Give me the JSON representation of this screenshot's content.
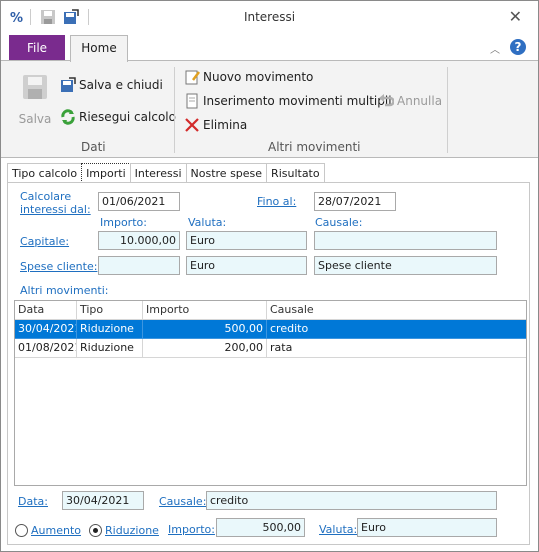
{
  "window": {
    "title": "Interessi"
  },
  "ribbon_tabs": {
    "file": "File",
    "home": "Home"
  },
  "ribbon": {
    "salva": "Salva",
    "salva_e_chiudi": "Salva e chiudi",
    "riesegui_calcolo": "Riesegui calcolo",
    "group_dati": "Dati",
    "nuovo_movimento": "Nuovo movimento",
    "inserimento_multipli": "Inserimento movimenti multipli",
    "annulla": "Annulla",
    "elimina": "Elimina",
    "group_altri": "Altri movimenti"
  },
  "page_tabs": [
    "Tipo calcolo",
    "Importi",
    "Interessi",
    "Nostre spese",
    "Risultato"
  ],
  "form": {
    "calcolare_label_1": "Calcolare",
    "calcolare_label_2": "interessi dal:",
    "dal_value": "01/06/2021",
    "fino_al_label": "Fino al:",
    "fino_al_value": "28/07/2021",
    "hdr_importo": "Importo:",
    "hdr_valuta": "Valuta:",
    "hdr_causale": "Causale:",
    "capitale_label": "Capitale:",
    "capitale_importo": "10.000,00",
    "capitale_valuta": "Euro",
    "capitale_causale": "",
    "spese_label": "Spese cliente:",
    "spese_importo": "",
    "spese_valuta": "Euro",
    "spese_causale": "Spese cliente",
    "altri_movimenti": "Altri movimenti:"
  },
  "grid": {
    "columns": [
      "Data",
      "Tipo",
      "Importo",
      "Causale"
    ],
    "rows": [
      {
        "data": "30/04/2021",
        "tipo": "Riduzione",
        "importo": "500,00",
        "causale": "credito"
      },
      {
        "data": "01/08/2021",
        "tipo": "Riduzione",
        "importo": "200,00",
        "causale": "rata"
      }
    ]
  },
  "detail": {
    "data_label": "Data:",
    "data_value": "30/04/2021",
    "causale_label": "Causale:",
    "causale_value": "credito",
    "aumento": "Aumento",
    "riduzione": "Riduzione",
    "importo_label": "Importo:",
    "importo_value": "500,00",
    "valuta_label": "Valuta:",
    "valuta_value": "Euro"
  },
  "colors": {
    "file_tab": "#7a2b8e",
    "label_blue": "#1f6fc0",
    "field_bg": "#eaf8fb",
    "selection": "#0078d7"
  }
}
